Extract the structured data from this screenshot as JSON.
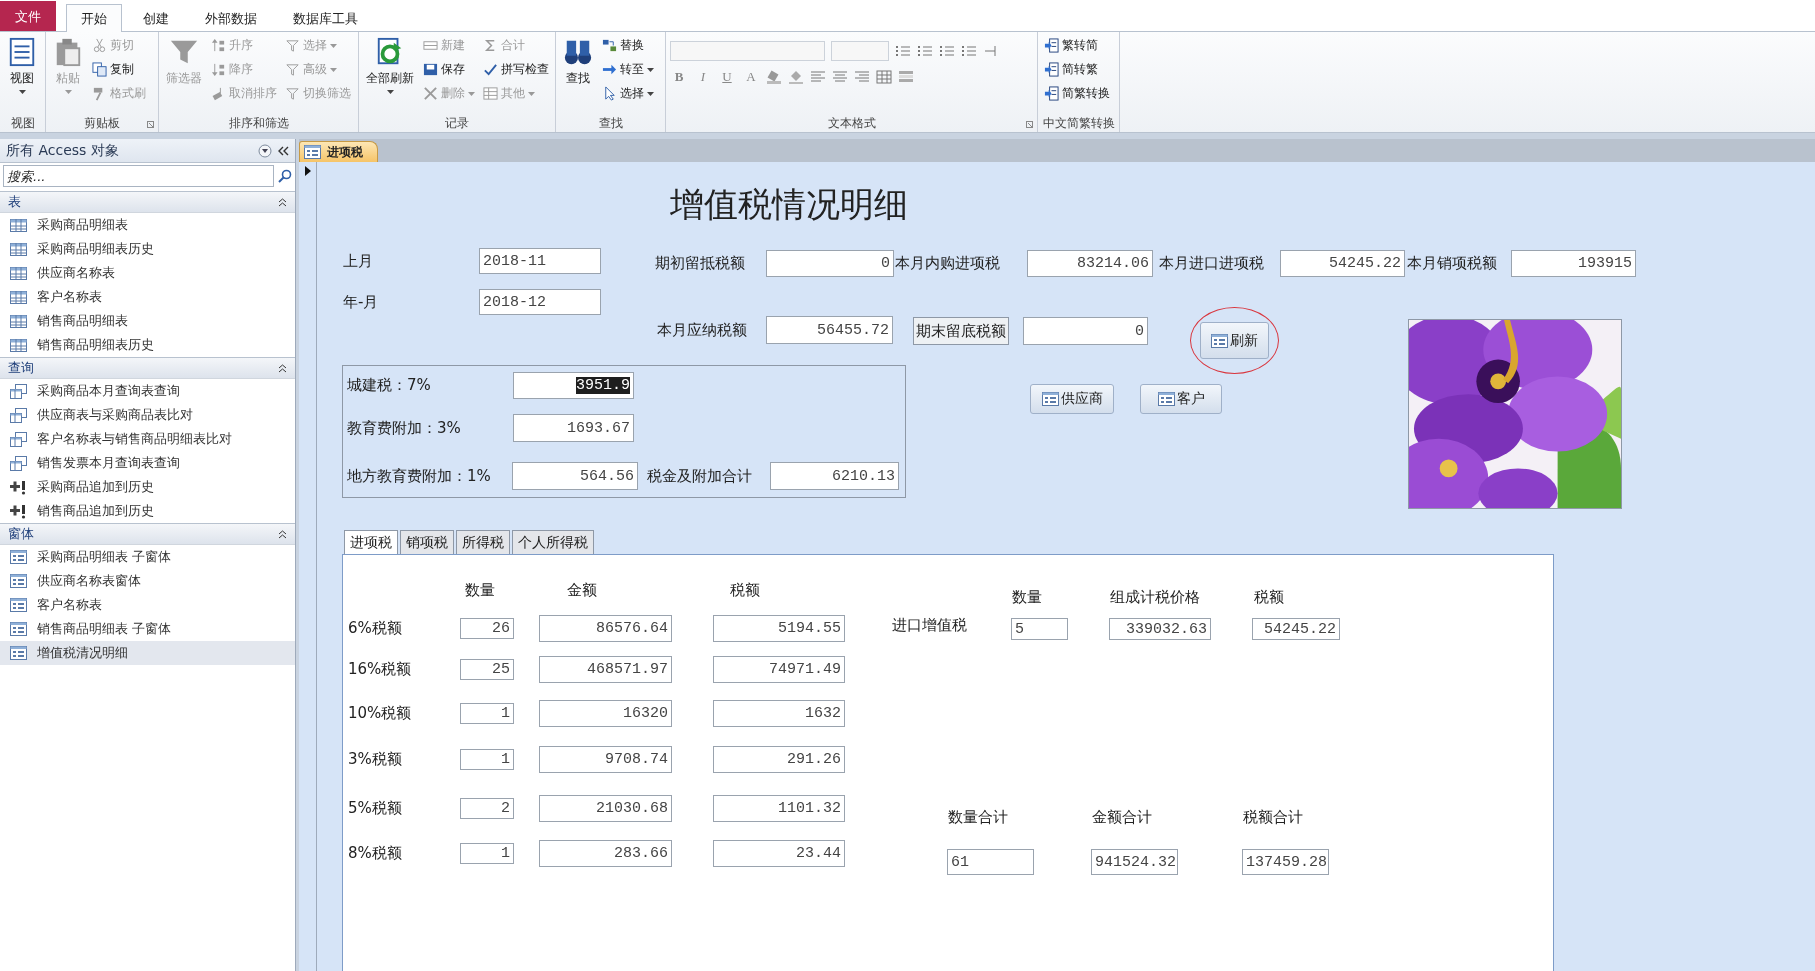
{
  "ribbon_tabs": [
    {
      "label": "文件",
      "kind": "file"
    },
    {
      "label": "开始",
      "kind": "tab",
      "selected": true
    },
    {
      "label": "创建",
      "kind": "tab",
      "selected": false
    },
    {
      "label": "外部数据",
      "kind": "tab",
      "selected": false
    },
    {
      "label": "数据库工具",
      "kind": "tab",
      "selected": false
    }
  ],
  "ribbon_groups": [
    {
      "label": "视图",
      "kind": "commands",
      "launcher": false,
      "items": [
        {
          "label": "视图",
          "kind": "large",
          "disabled": false,
          "dropdown": true
        }
      ]
    },
    {
      "label": "剪贴板",
      "kind": "commands",
      "launcher": true,
      "items": [
        {
          "label": "粘贴",
          "kind": "large",
          "disabled": true,
          "dropdown": true
        },
        {
          "label": "剪切",
          "kind": "small",
          "disabled": true,
          "dropdown": false
        },
        {
          "label": "复制",
          "kind": "small",
          "disabled": false,
          "dropdown": false
        },
        {
          "label": "格式刷",
          "kind": "small",
          "disabled": true,
          "dropdown": false
        }
      ]
    },
    {
      "label": "排序和筛选",
      "kind": "commands",
      "launcher": false,
      "items": [
        {
          "label": "筛选器",
          "kind": "large",
          "disabled": true,
          "dropdown": false
        },
        {
          "label": "升序",
          "kind": "small",
          "disabled": true,
          "dropdown": false
        },
        {
          "label": "降序",
          "kind": "small",
          "disabled": true,
          "dropdown": false
        },
        {
          "label": "取消排序",
          "kind": "small",
          "disabled": true,
          "dropdown": false
        },
        {
          "label": "选择",
          "kind": "small",
          "disabled": true,
          "dropdown": true
        },
        {
          "label": "高级",
          "kind": "small",
          "disabled": true,
          "dropdown": true
        },
        {
          "label": "切换筛选",
          "kind": "small",
          "disabled": true,
          "dropdown": false
        }
      ]
    },
    {
      "label": "记录",
      "kind": "commands",
      "launcher": false,
      "items": [
        {
          "label": "全部刷新",
          "kind": "large",
          "disabled": false,
          "dropdown": true
        },
        {
          "label": "新建",
          "kind": "small",
          "disabled": true,
          "dropdown": false
        },
        {
          "label": "保存",
          "kind": "small",
          "disabled": false,
          "dropdown": false
        },
        {
          "label": "删除",
          "kind": "small",
          "disabled": true,
          "dropdown": true
        },
        {
          "label": "合计",
          "kind": "small",
          "disabled": true,
          "dropdown": false
        },
        {
          "label": "拼写检查",
          "kind": "small",
          "disabled": false,
          "dropdown": false
        },
        {
          "label": "其他",
          "kind": "small",
          "disabled": true,
          "dropdown": true
        }
      ]
    },
    {
      "label": "查找",
      "kind": "commands",
      "launcher": false,
      "items": [
        {
          "label": "查找",
          "kind": "large",
          "disabled": false,
          "dropdown": false
        },
        {
          "label": "替换",
          "kind": "small",
          "disabled": false,
          "dropdown": false
        },
        {
          "label": "转至",
          "kind": "small",
          "disabled": false,
          "dropdown": true
        },
        {
          "label": "选择",
          "kind": "small",
          "disabled": false,
          "dropdown": true
        }
      ]
    },
    {
      "label": "文本格式",
      "kind": "format",
      "launcher": true,
      "format_buttons": [
        {
          "label": "B"
        },
        {
          "label": "I"
        },
        {
          "label": "U"
        },
        {
          "label": "A"
        }
      ]
    },
    {
      "label": "中文简繁转换",
      "kind": "commands",
      "launcher": false,
      "items": [
        {
          "label": "繁转简",
          "kind": "small",
          "disabled": false,
          "dropdown": false
        },
        {
          "label": "简转繁",
          "kind": "small",
          "disabled": false,
          "dropdown": false
        },
        {
          "label": "简繁转换",
          "kind": "small",
          "disabled": false,
          "dropdown": false
        }
      ]
    }
  ],
  "sidebar": {
    "title": "所有 Access 对象",
    "search_placeholder": "搜索...",
    "sections": [
      {
        "label": "表",
        "expanded": true,
        "items": [
          {
            "label": "采购商品明细表",
            "kind": "table",
            "selected": false
          },
          {
            "label": "采购商品明细表历史",
            "kind": "table",
            "selected": false
          },
          {
            "label": "供应商名称表",
            "kind": "table",
            "selected": false
          },
          {
            "label": "客户名称表",
            "kind": "table",
            "selected": false
          },
          {
            "label": "销售商品明细表",
            "kind": "table",
            "selected": false
          },
          {
            "label": "销售商品明细表历史",
            "kind": "table",
            "selected": false
          }
        ]
      },
      {
        "label": "查询",
        "expanded": true,
        "items": [
          {
            "label": "采购商品本月查询表查询",
            "kind": "query",
            "selected": false
          },
          {
            "label": "供应商表与采购商品表比对",
            "kind": "query",
            "selected": false
          },
          {
            "label": "客户名称表与销售商品明细表比对",
            "kind": "query",
            "selected": false
          },
          {
            "label": "销售发票本月查询表查询",
            "kind": "query",
            "selected": false
          },
          {
            "label": "采购商品追加到历史",
            "kind": "append",
            "selected": false
          },
          {
            "label": "销售商品追加到历史",
            "kind": "append",
            "selected": false
          }
        ]
      },
      {
        "label": "窗体",
        "expanded": true,
        "items": [
          {
            "label": "采购商品明细表 子窗体",
            "kind": "form",
            "selected": false
          },
          {
            "label": "供应商名称表窗体",
            "kind": "form",
            "selected": false
          },
          {
            "label": "客户名称表",
            "kind": "form",
            "selected": false
          },
          {
            "label": "销售商品明细表 子窗体",
            "kind": "form",
            "selected": false
          },
          {
            "label": "增值税清况明细",
            "kind": "form",
            "selected": true
          }
        ]
      }
    ]
  },
  "form": {
    "document_tab": "进项税",
    "title": "增值税情况明细",
    "fields": [
      {
        "label": "上月",
        "value": "2018-11",
        "kind": "plain"
      },
      {
        "label": "年-月",
        "value": "2018-12",
        "kind": "plain"
      },
      {
        "label": "期初留抵税额",
        "value": "0",
        "kind": "plain"
      },
      {
        "label": "本月内购进项税",
        "value": "83214.06",
        "kind": "plain"
      },
      {
        "label": "本月进口进项税",
        "value": "54245.22",
        "kind": "plain"
      },
      {
        "label": "本月销项税额",
        "value": "193915",
        "kind": "plain"
      },
      {
        "label": "本月应纳税额",
        "value": "56455.72",
        "kind": "plain"
      },
      {
        "label": "期末留底税额",
        "value": "0",
        "kind": "boxed"
      }
    ],
    "buttons": [
      {
        "label": "刷新",
        "circled": true
      },
      {
        "label": "供应商",
        "circled": false
      },
      {
        "label": "客户",
        "circled": false
      }
    ],
    "surtax_fields": [
      {
        "label": "城建税：7%",
        "value": "3951.9",
        "highlighted": true
      },
      {
        "label": "教育费附加：3%",
        "value": "1693.67",
        "highlighted": false
      },
      {
        "label": "地方教育费附加：1%",
        "value": "564.56",
        "highlighted": false
      },
      {
        "label": "税金及附加合计",
        "value": "6210.13",
        "highlighted": false
      }
    ],
    "tabs": [
      {
        "label": "进项税",
        "selected": true
      },
      {
        "label": "销项税",
        "selected": false
      },
      {
        "label": "所得税",
        "selected": false
      },
      {
        "label": "个人所得税",
        "selected": false
      }
    ],
    "tab_page": {
      "headers": [
        "数量",
        "金额",
        "税额"
      ],
      "rows": [
        {
          "label": "6%税额",
          "quantity": "26",
          "amount": "86576.64",
          "tax": "5194.55"
        },
        {
          "label": "16%税额",
          "quantity": "25",
          "amount": "468571.97",
          "tax": "74971.49"
        },
        {
          "label": "10%税额",
          "quantity": "1",
          "amount": "16320",
          "tax": "1632"
        },
        {
          "label": "3%税额",
          "quantity": "1",
          "amount": "9708.74",
          "tax": "291.26"
        },
        {
          "label": "5%税额",
          "quantity": "2",
          "amount": "21030.68",
          "tax": "1101.32"
        },
        {
          "label": "8%税额",
          "quantity": "1",
          "amount": "283.66",
          "tax": "23.44"
        }
      ],
      "import_vat": {
        "label": "进口增值税",
        "headers": [
          "数量",
          "组成计税价格",
          "税额"
        ],
        "values": [
          "5",
          "339032.63",
          "54245.22"
        ]
      },
      "totals": {
        "headers": [
          "数量合计",
          "金额合计",
          "税额合计"
        ],
        "values": [
          "61",
          "941524.32",
          "137459.28"
        ]
      }
    }
  }
}
